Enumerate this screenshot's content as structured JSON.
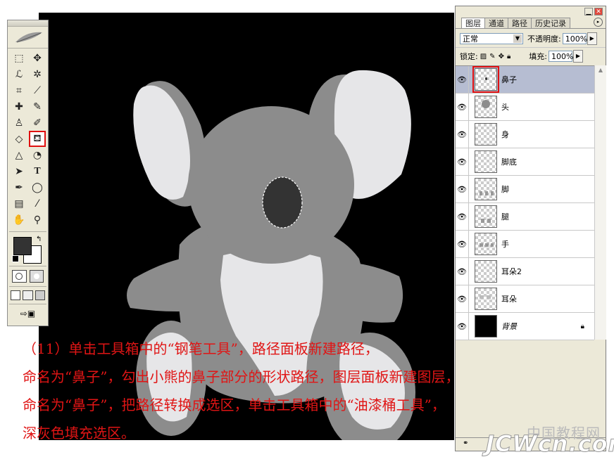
{
  "layers_panel": {
    "tabs": [
      "图层",
      "通道",
      "路径",
      "历史记录"
    ],
    "blend_mode": "正常",
    "opacity_label": "不透明度:",
    "opacity_value": "100%",
    "lock_label": "锁定:",
    "fill_label": "填充:",
    "fill_value": "100%",
    "layers": [
      {
        "name": "鼻子",
        "selected": true,
        "locked": false
      },
      {
        "name": "头",
        "selected": false,
        "locked": false
      },
      {
        "name": "身",
        "selected": false,
        "locked": false
      },
      {
        "name": "脚底",
        "selected": false,
        "locked": false
      },
      {
        "name": "脚",
        "selected": false,
        "locked": false
      },
      {
        "name": "腿",
        "selected": false,
        "locked": false
      },
      {
        "name": "手",
        "selected": false,
        "locked": false
      },
      {
        "name": "耳朵2",
        "selected": false,
        "locked": false
      },
      {
        "name": "耳朵",
        "selected": false,
        "locked": false
      },
      {
        "name": "背景",
        "selected": false,
        "locked": true
      }
    ]
  },
  "toolbox": {
    "selected_tool": "paint-bucket-tool",
    "tools": [
      "marquee-icon",
      "move-icon",
      "lasso-icon",
      "magic-wand-icon",
      "crop-icon",
      "slice-icon",
      "healing-brush-icon",
      "brush-icon",
      "clone-stamp-icon",
      "history-brush-icon",
      "eraser-icon",
      "paint-bucket-icon",
      "blur-icon",
      "dodge-icon",
      "path-select-icon",
      "type-icon",
      "pen-icon",
      "ellipse-icon",
      "notes-icon",
      "eyedropper-icon",
      "hand-icon",
      "zoom-icon"
    ]
  },
  "colors": {
    "foreground": "#333333",
    "background": "#ffffff",
    "bear_dark": "#8c8c8c",
    "bear_light": "#e6e6e8",
    "nose": "#333333"
  },
  "caption": [
    "（11）单击工具箱中的“钢笔工具”，路径面板新建路径，",
    "命名为“鼻子”，勾出小熊的鼻子部分的形状路径，图层面板新建图层，",
    "命名为“鼻子”，把路径转换成选区，单击工具箱中的“油漆桶工具”，",
    "深灰色填充选区。"
  ],
  "watermark": {
    "line1": "中国教程网",
    "line2": "JCWcn.com"
  }
}
